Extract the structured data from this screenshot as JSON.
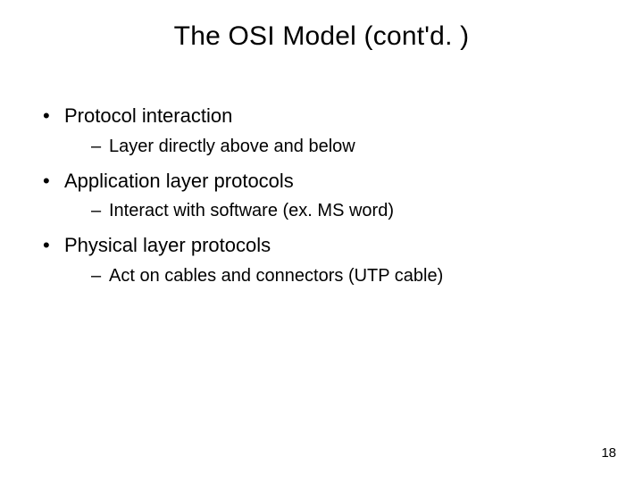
{
  "title": "The OSI Model (cont'd. )",
  "bullets": [
    {
      "text": "Protocol interaction",
      "sub": [
        "Layer directly above and below"
      ]
    },
    {
      "text": "Application layer protocols",
      "sub": [
        "Interact with software (ex. MS word)"
      ]
    },
    {
      "text": "Physical layer protocols",
      "sub": [
        "Act on cables and connectors (UTP cable)"
      ]
    }
  ],
  "page_number": "18"
}
